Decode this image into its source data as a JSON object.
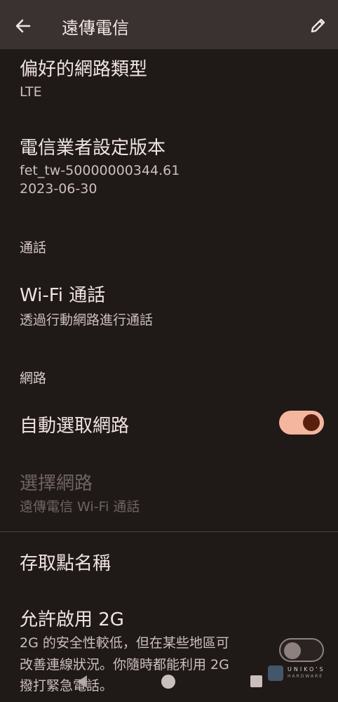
{
  "appbar": {
    "title": "遠傳電信",
    "back_icon": "arrow-back-icon",
    "edit_icon": "pencil-icon"
  },
  "preferred_network": {
    "title": "偏好的網路類型",
    "value": "LTE"
  },
  "carrier_config": {
    "title": "電信業者設定版本",
    "version": "fet_tw-50000000344.61",
    "date": "2023-06-30"
  },
  "calling_section": {
    "header": "通話"
  },
  "wifi_calling": {
    "title": "Wi-Fi 通話",
    "subtitle": "透過行動網路進行通話"
  },
  "network_section": {
    "header": "網路"
  },
  "auto_select": {
    "title": "自動選取網路",
    "enabled": true
  },
  "choose_network": {
    "title": "選擇網路",
    "subtitle": "遠傳電信 Wi-Fi 通話"
  },
  "apn": {
    "title": "存取點名稱"
  },
  "allow_2g": {
    "title": "允許啟用 2G",
    "desc_line1": "2G 的安全性較低，但在某些地區可",
    "desc_line2": "改善連線狀況。你隨時都能利用 2G",
    "desc_line3": "撥打緊急電話。",
    "enabled": false
  },
  "watermark": {
    "brand": "UNIKO'S",
    "tag": "HARDWARE"
  },
  "colors": {
    "background": "#1f1918",
    "appbar": "#3a3231",
    "toggle_on_track": "#f5b69f",
    "toggle_on_thumb": "#5a1f0f",
    "toggle_off_thumb": "#8d8180"
  }
}
